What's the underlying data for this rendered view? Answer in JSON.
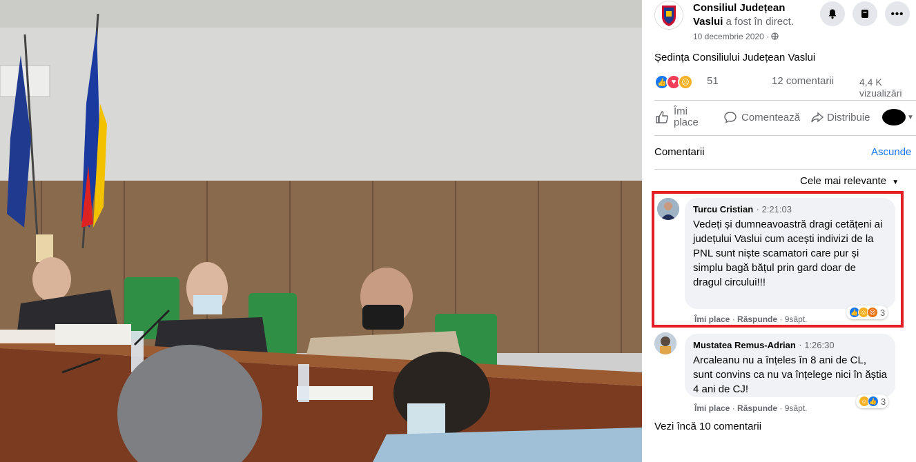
{
  "post": {
    "page_name": "Consiliul Județean Vaslui",
    "live_text": "a fost în direct.",
    "date": "10 decembrie 2020 ·",
    "title": "Ședința Consiliului Județean Vaslui",
    "reaction_count": "51",
    "comment_count": "12 comentarii",
    "views": "4,4 K vizualizări"
  },
  "actions": {
    "like": "Îmi place",
    "comment": "Comentează",
    "share": "Distribuie"
  },
  "comments_section": {
    "heading": "Comentarii",
    "hide": "Ascunde",
    "sort": "Cele mai relevante",
    "more": "Vezi încă 10 comentarii"
  },
  "comments": [
    {
      "author": "Turcu Cristian",
      "time": "· 2:21:03",
      "text": "Vedeți și dumneavoastră dragi cetățeni ai județului Vaslui cum acești indivizi de la PNL sunt niște scamatori care pur și simplu bagă bățul prin gard doar de dragul circului!!!",
      "like": "Îmi place",
      "reply": "Răspunde",
      "age": "9săpt.",
      "reaction_count": "3",
      "reaction_icons": [
        "like-icon",
        "haha-icon",
        "angry-icon"
      ]
    },
    {
      "author": "Mustatea Remus-Adrian",
      "time": "· 1:26:30",
      "text": "Arcaleanu nu a înțeles în 8 ani de CL, sunt convins ca nu va înțelege nici în ăștia 4 ani de CJ!",
      "like": "Îmi place",
      "reply": "Răspunde",
      "age": "9săpt.",
      "reaction_count": "3",
      "reaction_icons": [
        "haha-icon",
        "like-icon"
      ]
    }
  ],
  "colors": {
    "accent": "#1877f2",
    "highlight": "#e41e25",
    "secondary_text": "#65676b",
    "bubble": "#f0f2f5"
  }
}
